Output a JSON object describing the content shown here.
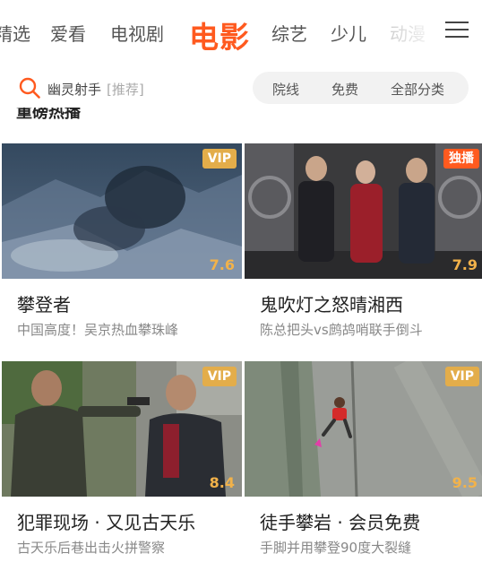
{
  "top_nav": {
    "tabs": [
      {
        "label": "精选",
        "state": "partial"
      },
      {
        "label": "爱看",
        "state": "normal"
      },
      {
        "label": "电视剧",
        "state": "normal"
      },
      {
        "label": "电影",
        "state": "active"
      },
      {
        "label": "综艺",
        "state": "normal"
      },
      {
        "label": "少儿",
        "state": "normal"
      },
      {
        "label": "动漫",
        "state": "faded"
      }
    ],
    "active_color": "#ff5a1f",
    "menu_icon": "menu-icon"
  },
  "search": {
    "icon": "search-icon",
    "query": "幽灵射手",
    "tag": "[推荐]"
  },
  "filters": [
    "院线",
    "免费",
    "全部分类"
  ],
  "section": {
    "title": "重磅热播"
  },
  "cards": [
    {
      "title": "攀登者",
      "subtitle": "中国高度！吴京热血攀珠峰",
      "badge": "VIP",
      "badge_type": "vip",
      "score": "7.6"
    },
    {
      "title": "鬼吹灯之怒晴湘西",
      "subtitle": "陈总把头vs鹧鸪哨联手倒斗",
      "badge": "独播",
      "badge_type": "exclusive",
      "score": "7.9"
    },
    {
      "title": "犯罪现场 · 又见古天乐",
      "subtitle": "古天乐后巷出击火拼警察",
      "badge": "VIP",
      "badge_type": "vip",
      "score": "8.4"
    },
    {
      "title": "徒手攀岩 · 会员免费",
      "subtitle": "手脚并用攀登90度大裂缝",
      "badge": "VIP",
      "badge_type": "vip",
      "score": "9.5"
    }
  ],
  "colors": {
    "vip_badge": "#e3ad4a",
    "exclusive_badge": "#ff5a1f",
    "score": "#f2b24a"
  }
}
